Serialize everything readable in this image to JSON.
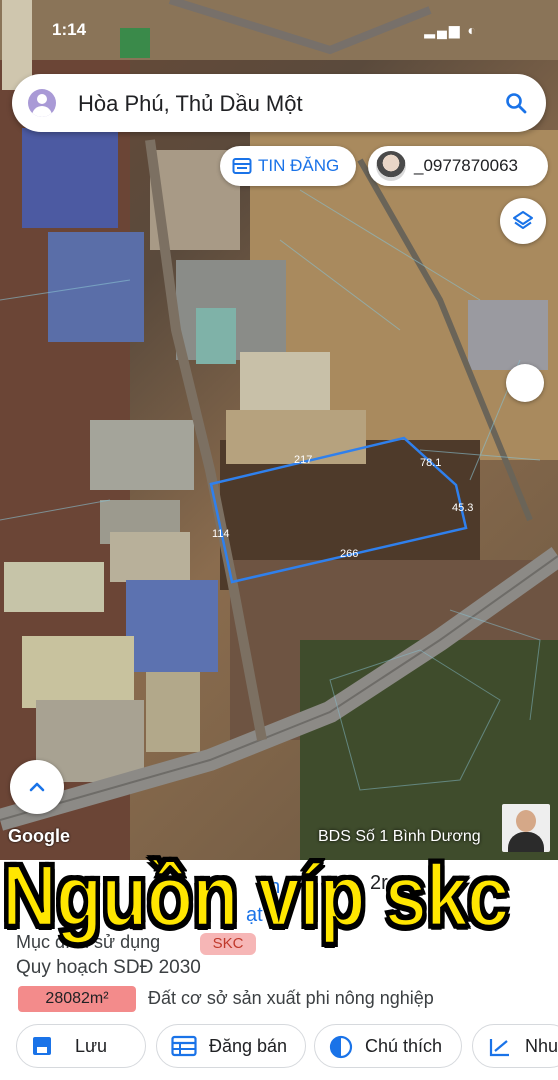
{
  "status_bar": {
    "time": "1:14",
    "icons": "▂▄▆ ◐"
  },
  "search": {
    "location": "Hòa Phú, Thủ Dầu Một"
  },
  "chips": {
    "post_label": "TIN ĐĂNG",
    "phone_label": "_0977870063"
  },
  "plot": {
    "edges": [
      "217",
      "78.1",
      "45.3",
      "266",
      "114"
    ]
  },
  "attribution": {
    "google": "Google",
    "agency": "BDS Số 1 Bình Dương"
  },
  "panel": {
    "partial_text": [
      "en",
      "2r",
      "ạt"
    ],
    "use_label": "Mục đích sử dụng",
    "use_badge": "SKC",
    "plan_label": "Quy hoạch SDĐ 2030",
    "area_value": "28082m²",
    "area_desc": "Đất cơ sở sản xuất phi nông nghiệp"
  },
  "buttons": {
    "save": "Lưu",
    "sell": "Đăng bán",
    "legend": "Chú thích",
    "more": "Nhu"
  },
  "overlay": {
    "caption": "Nguồn víp skc"
  },
  "colors": {
    "accent": "#1a73e8",
    "caption": "#ffe600",
    "badge": "#f6b6b6"
  }
}
